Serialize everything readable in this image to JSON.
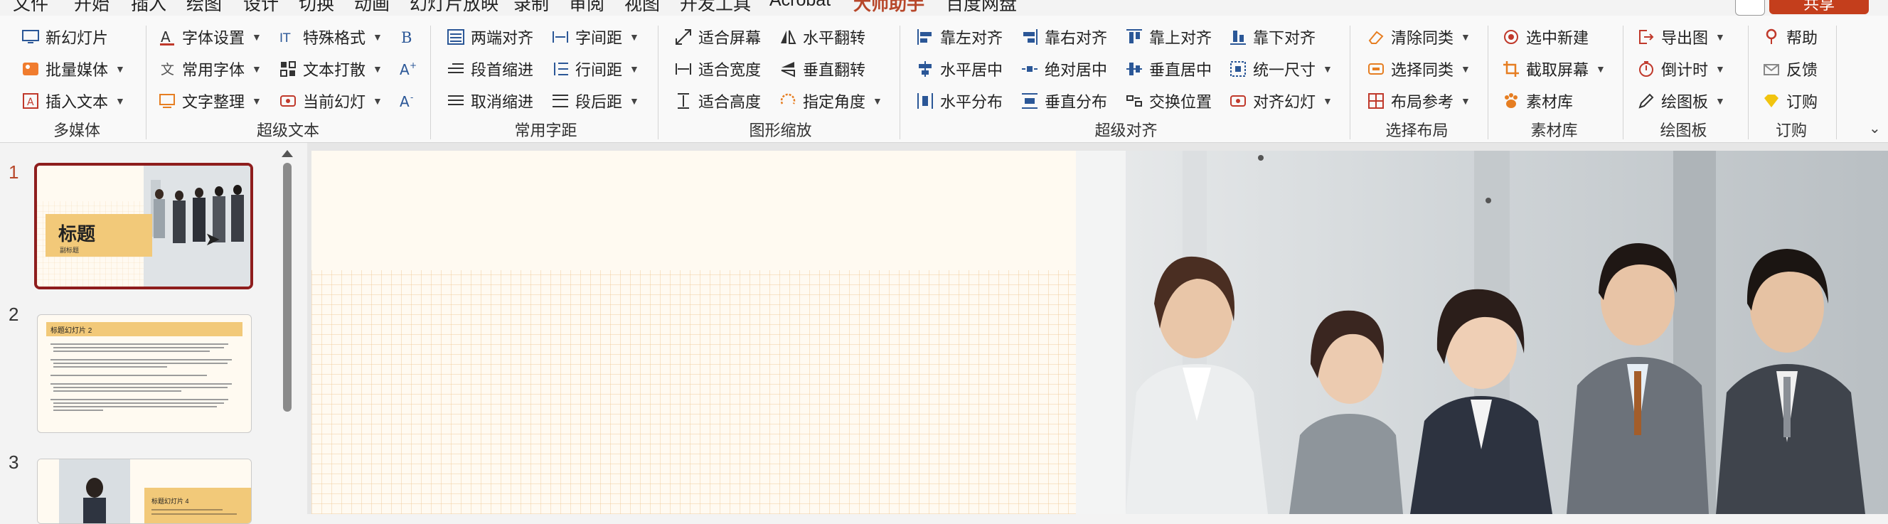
{
  "menu": {
    "tabs": [
      "文件",
      "开始",
      "插入",
      "绘图",
      "设计",
      "切换",
      "动画",
      "幻灯片放映",
      "录制",
      "审阅",
      "视图",
      "开发工具",
      "Acrobat",
      "大师助手",
      "百度网盘"
    ],
    "active_tab": "大师助手",
    "share_label": "共享"
  },
  "ribbon": {
    "groups": {
      "multimedia": {
        "label": "多媒体",
        "new_slide": "新幻灯片",
        "batch_media": "批量媒体",
        "insert_text": "插入文本"
      },
      "super_text": {
        "label": "超级文本",
        "font_settings": "字体设置",
        "special_format": "特殊格式",
        "common_fonts": "常用字体",
        "text_scatter": "文本打散",
        "text_organize": "文字整理",
        "current_slide": "当前幻灯"
      },
      "spacing": {
        "label": "常用字距",
        "justify": "两端对齐",
        "char_spacing": "字间距",
        "first_indent": "段首缩进",
        "line_spacing": "行间距",
        "cancel_indent": "取消缩进",
        "para_after": "段后距"
      },
      "scaling": {
        "label": "图形缩放",
        "fit_screen": "适合屏幕",
        "flip_h": "水平翻转",
        "fit_width": "适合宽度",
        "flip_v": "垂直翻转",
        "fit_height": "适合高度",
        "set_angle": "指定角度"
      },
      "align": {
        "label": "超级对齐",
        "align_left": "靠左对齐",
        "align_right": "靠右对齐",
        "align_top": "靠上对齐",
        "align_bottom": "靠下对齐",
        "center_h": "水平居中",
        "abs_center": "绝对居中",
        "center_v": "垂直居中",
        "same_size": "统一尺寸",
        "dist_h": "水平分布",
        "dist_v": "垂直分布",
        "swap": "交换位置",
        "align_slide": "对齐幻灯"
      },
      "select_layout": {
        "label": "选择布局",
        "clear_same": "清除同类",
        "select_same": "选择同类",
        "layout_ref": "布局参考"
      },
      "material": {
        "label": "素材库",
        "select_new": "选中新建",
        "screenshot": "截取屏幕",
        "library": "素材库"
      },
      "drawing": {
        "label": "绘图板",
        "export_img": "导出图",
        "countdown": "倒计时",
        "drawing_board": "绘图板"
      },
      "subscribe": {
        "label": "订购",
        "help": "帮助",
        "feedback": "反馈",
        "order": "订购"
      }
    }
  },
  "slides": [
    {
      "number": "1",
      "title": "标题",
      "subtitle": "副标题"
    },
    {
      "number": "2",
      "title": "标题幻灯片 2"
    },
    {
      "number": "3",
      "title": "标题幻灯片 4"
    }
  ],
  "colors": {
    "accent": "#b7472a",
    "slide_bg": "#fffaf1",
    "title_band": "#f2c979",
    "active_thumb_border": "#8e1d1d"
  }
}
